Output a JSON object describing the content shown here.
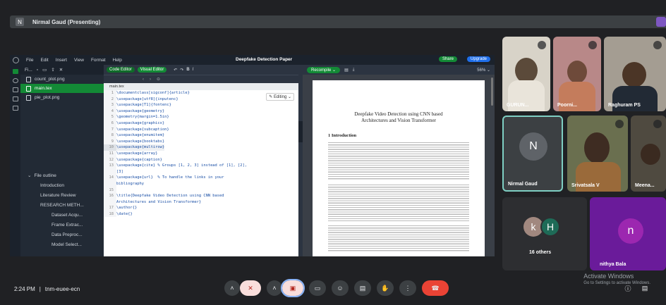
{
  "presenter_bar": {
    "initial": "N",
    "text": "Nirmal Gaud (Presenting)"
  },
  "overleaf": {
    "menu": [
      "File",
      "Edit",
      "Insert",
      "View",
      "Format",
      "Help"
    ],
    "project_title": "Deepfake Detection Paper",
    "share_label": "Share",
    "upgrade_label": "Upgrade",
    "code_editor_label": "Code Editor",
    "visual_editor_label": "Visual Editor",
    "file_tree_header": "Fi...",
    "files": [
      {
        "name": "count_plot.png",
        "selected": false
      },
      {
        "name": "main.tex",
        "selected": true
      },
      {
        "name": "pie_plot.png",
        "selected": false
      }
    ],
    "outline_header": "File outline",
    "outline_items": [
      {
        "label": "Introduction",
        "sub": false
      },
      {
        "label": "Literature Review",
        "sub": false
      },
      {
        "label": "RESEARCH METH...",
        "sub": false
      },
      {
        "label": "Dataset Acqu...",
        "sub": true
      },
      {
        "label": "Frame Extrac...",
        "sub": true
      },
      {
        "label": "Data Preproc...",
        "sub": true
      },
      {
        "label": "Model Select...",
        "sub": true
      }
    ],
    "open_file": "main.tex",
    "editing_label": "Editing",
    "code_lines": [
      {
        "n": "1",
        "t": "\\documentclass[sigconf]{article}"
      },
      {
        "n": "2",
        "t": "\\usepackage[utf8]{inputenc}"
      },
      {
        "n": "3",
        "t": "\\usepackage[T1]{fontenc}"
      },
      {
        "n": "4",
        "t": "\\usepackage{geometry}"
      },
      {
        "n": "5",
        "t": "\\geometry{margin=1.5in}"
      },
      {
        "n": "6",
        "t": "\\usepackage{graphicx}"
      },
      {
        "n": "7",
        "t": "\\usepackage{subcaption}"
      },
      {
        "n": "8",
        "t": "\\usepackage{enumitem}"
      },
      {
        "n": "9",
        "t": "\\usepackage{booktabs}"
      },
      {
        "n": "10",
        "t": "\\usepackage{multirow}"
      },
      {
        "n": "11",
        "t": "\\usepackage{array}"
      },
      {
        "n": "12",
        "t": "\\usepackage{caption}"
      },
      {
        "n": "13",
        "t": "\\usepackage{cite} % Groups [1, 2, 3] instead of [1], [2],"
      },
      {
        "n": "",
        "t": "[3]"
      },
      {
        "n": "14",
        "t": "\\usepackage{url}  % To handle the links in your"
      },
      {
        "n": "",
        "t": "bibliography"
      },
      {
        "n": "15",
        "t": ""
      },
      {
        "n": "16",
        "t": "\\title{Deepfake Video Detection using CNN based"
      },
      {
        "n": "",
        "t": "Architectures and Vision Transformer}"
      },
      {
        "n": "17",
        "t": "\\author{}"
      },
      {
        "n": "18",
        "t": "\\date{}"
      }
    ],
    "recompile_label": "Recompile",
    "zoom": "56%",
    "pdf_title_line1": "Deepfake Video Detection using CNN based",
    "pdf_title_line2": "Architectures and Vision Transformer",
    "pdf_section": "1  Introduction"
  },
  "participants": [
    {
      "name": "GURUN...",
      "label_color": "#ffffff"
    },
    {
      "name": "Poorni...",
      "label_color": "#ffffff"
    },
    {
      "name": "Raghuram PS",
      "label_color": "#ffffff"
    },
    {
      "name": "Nirmal Gaud",
      "initial": "N",
      "avatar_color": "#5f6368"
    },
    {
      "name": "Srivatsala V"
    },
    {
      "name": "Meena..."
    },
    {
      "others_label": "16 others",
      "av1": "k",
      "av2": "H",
      "av1_color": "#a1887f",
      "av2_color": "#1e6b57"
    },
    {
      "name": "nithya Bala",
      "initial": "n",
      "avatar_color": "#8e24aa",
      "bg": "#6a1b9a"
    }
  ],
  "bottom": {
    "time": "2:24 PM",
    "separator": "|",
    "meeting_code": "tnm-euee-ecn",
    "activate_title": "Activate Windows",
    "activate_sub": "Go to Settings to activate Windows."
  },
  "colors": {
    "meet_bg": "#202124",
    "hangup": "#ea4335",
    "selected_border": "#7fcfc3",
    "overleaf_green": "#138a36"
  }
}
